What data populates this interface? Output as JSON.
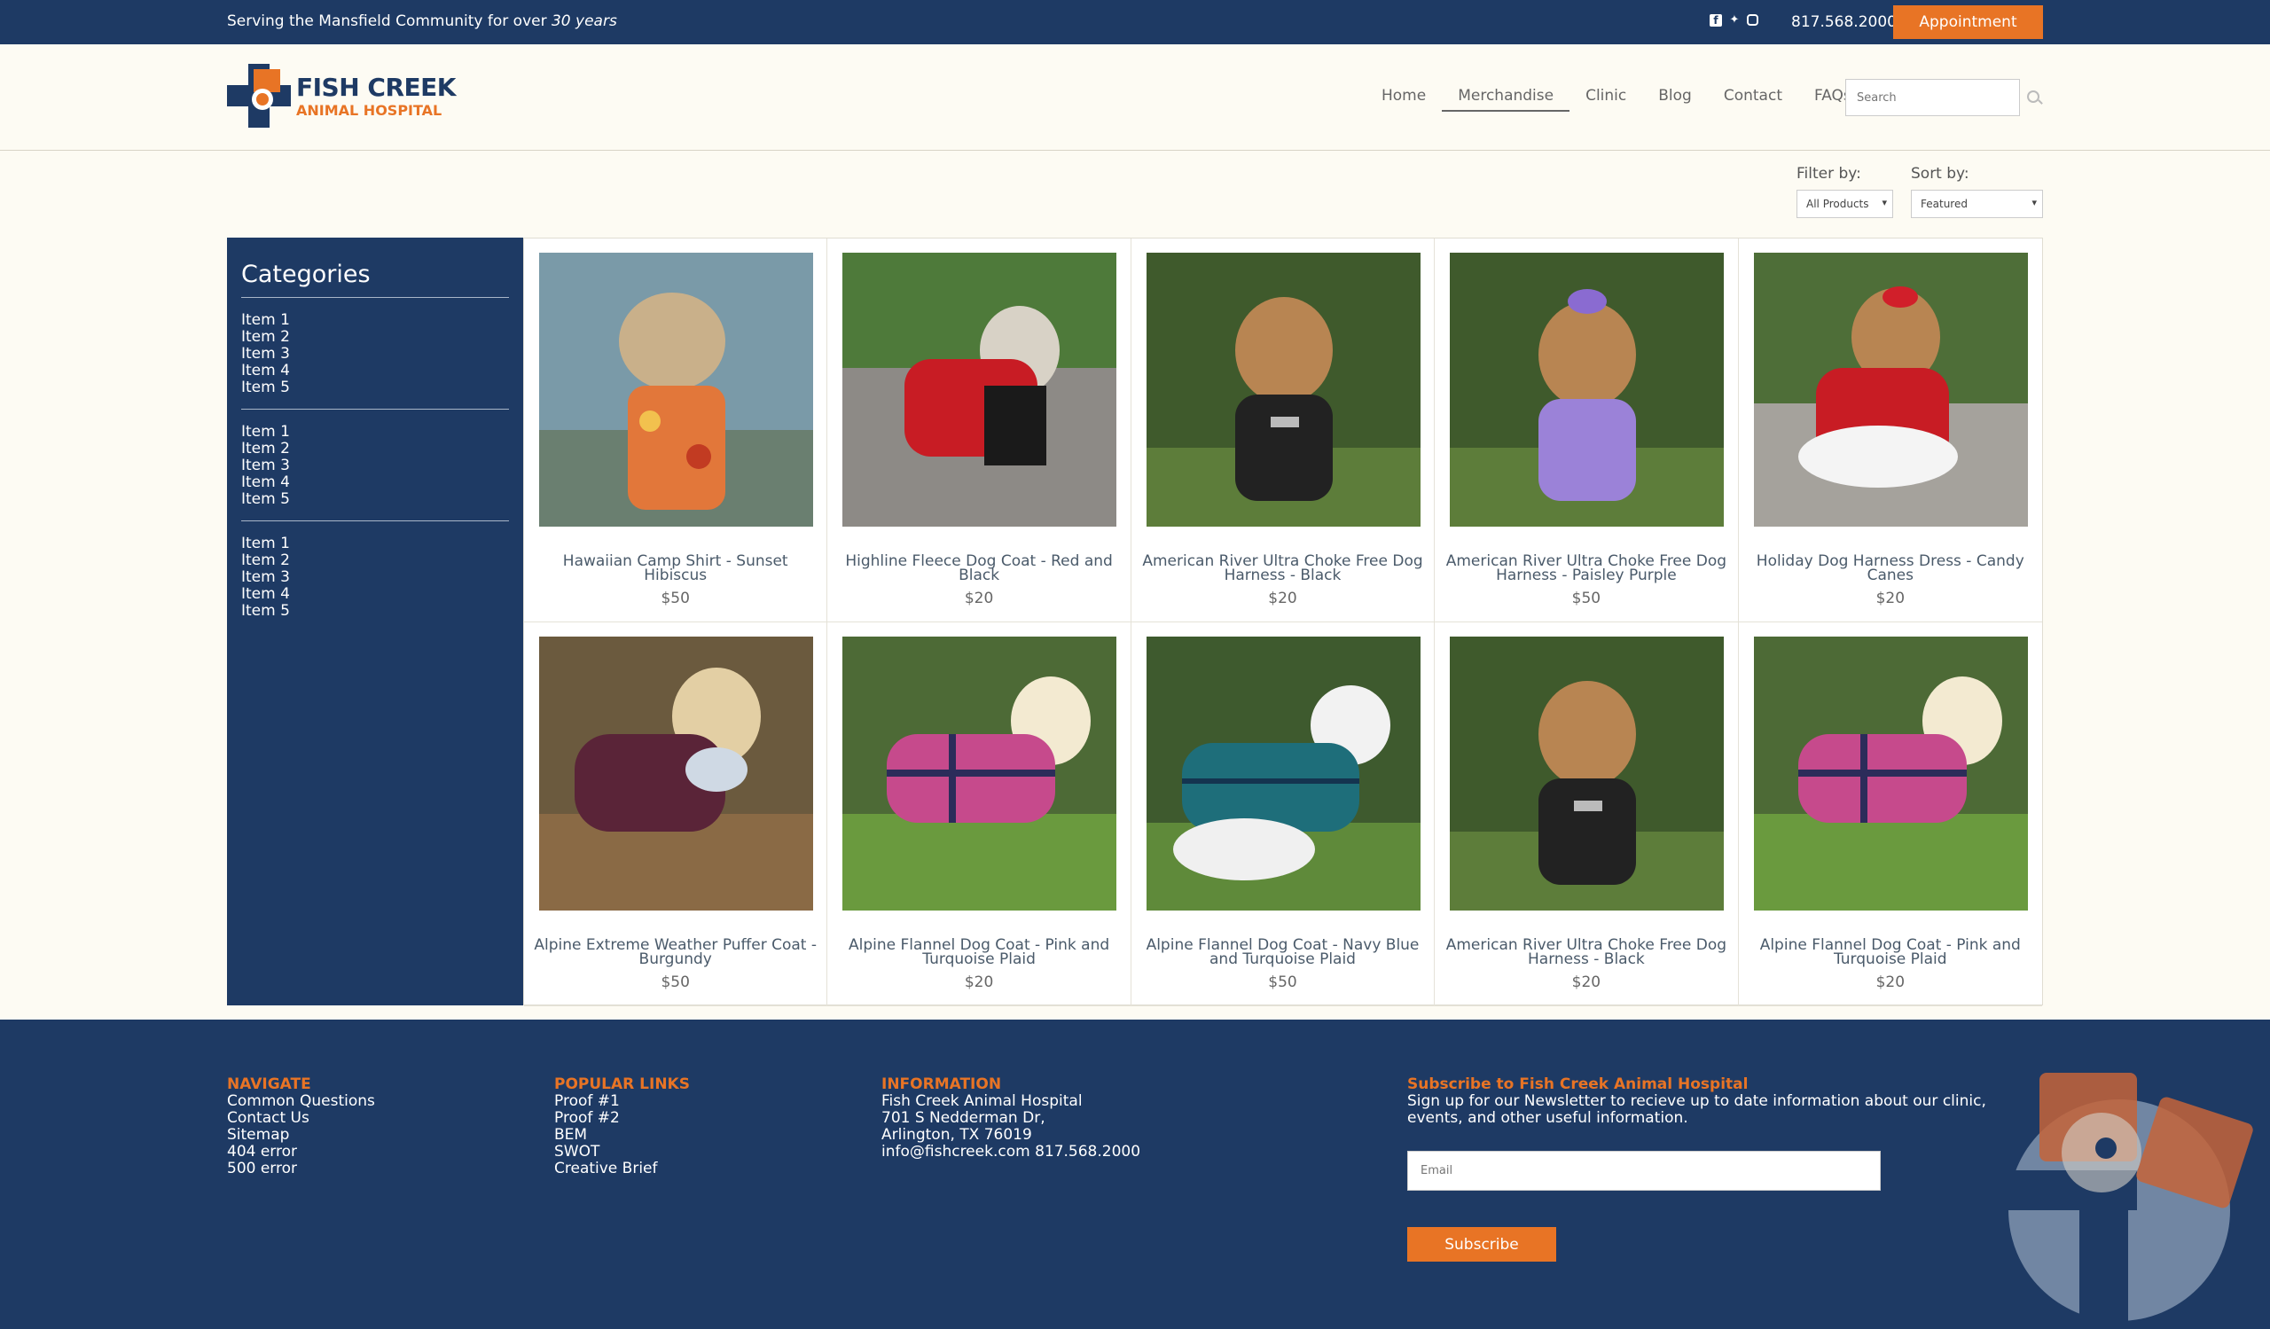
{
  "topbar": {
    "tagline": "Serving the Mansfield Community for over",
    "tagline_em": "30 years",
    "phone": "817.568.2000 |",
    "appointment_label": "Appointment"
  },
  "logo": {
    "name": "FISH CREEK",
    "sub": "ANIMAL HOSPITAL"
  },
  "nav": {
    "items": [
      "Home",
      "Merchandise",
      "Clinic",
      "Blog",
      "Contact",
      "FAQs"
    ],
    "active": "Merchandise"
  },
  "search": {
    "placeholder": "Search"
  },
  "filters": {
    "filter_label": "Filter by:",
    "filter_value": "All Products",
    "sort_label": "Sort by:",
    "sort_value": "Featured"
  },
  "sidebar": {
    "title": "Categories",
    "groups": [
      [
        "Item 1",
        "Item 2",
        "Item 3",
        "Item 4",
        "Item 5"
      ],
      [
        "Item 1",
        "Item 2",
        "Item 3",
        "Item 4",
        "Item 5"
      ],
      [
        "Item 1",
        "Item 2",
        "Item 3",
        "Item 4",
        "Item 5"
      ]
    ]
  },
  "products": [
    {
      "title": "Hawaiian Camp Shirt - Sunset Hibiscus",
      "price": "$50"
    },
    {
      "title": "Highline Fleece Dog Coat - Red and Black",
      "price": "$20"
    },
    {
      "title": "American River Ultra Choke Free Dog Harness - Black",
      "price": "$20"
    },
    {
      "title": "American River Ultra Choke Free Dog Harness - Paisley Purple",
      "price": "$50"
    },
    {
      "title": "Holiday Dog Harness Dress - Candy Canes",
      "price": "$20"
    },
    {
      "title": "Alpine Extreme Weather Puffer Coat - Burgundy",
      "price": "$50"
    },
    {
      "title": "Alpine Flannel Dog Coat - Pink and Turquoise Plaid",
      "price": "$20"
    },
    {
      "title": "Alpine Flannel Dog Coat - Navy Blue and Turquoise Plaid",
      "price": "$50"
    },
    {
      "title": "American River Ultra Choke Free Dog Harness - Black",
      "price": "$20"
    },
    {
      "title": "Alpine Flannel Dog Coat - Pink and Turquoise Plaid",
      "price": "$20"
    }
  ],
  "footer": {
    "navigate": {
      "heading": "NAVIGATE",
      "links": [
        "Common Questions",
        "Contact Us",
        "Sitemap",
        "404 error",
        "500 error"
      ]
    },
    "popular": {
      "heading": "POPULAR LINKS",
      "links": [
        "Proof #1",
        "Proof #2",
        "BEM",
        "SWOT",
        "Creative Brief"
      ]
    },
    "info": {
      "heading": "INFORMATION",
      "lines": [
        "Fish Creek Animal Hospital",
        "701 S Nedderman Dr,",
        "Arlington, TX 76019",
        "info@fishcreek.com 817.568.2000"
      ]
    },
    "subscribe": {
      "heading": "Subscribe to Fish Creek Animal Hospital",
      "text": "Sign up for our Newsletter to recieve up to date information about our clinic, events, and other useful information.",
      "email_placeholder": "Email",
      "button_label": "Subscribe"
    }
  },
  "colors": {
    "navy": "#1e3a64",
    "orange": "#e87425",
    "cream": "#fdfbf3"
  }
}
